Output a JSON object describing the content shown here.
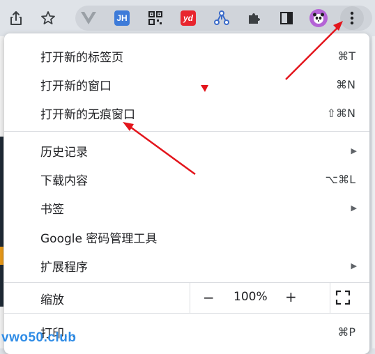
{
  "toolbar": {
    "icons": [
      "share-icon",
      "star-icon",
      "vue-devtools-icon",
      "jh-extension-icon",
      "qr-code-icon",
      "youdao-icon",
      "graph-extension-icon",
      "puzzle-extensions-icon",
      "side-panel-icon",
      "profile-avatar",
      "more-menu-icon"
    ],
    "jh_badge": "JH",
    "yd_badge": "yd"
  },
  "menu": {
    "new_tab": {
      "label": "打开新的标签页",
      "shortcut": "⌘T"
    },
    "new_window": {
      "label": "打开新的窗口",
      "shortcut": "⌘N"
    },
    "incognito": {
      "label": "打开新的无痕窗口",
      "shortcut": "⇧⌘N"
    },
    "history": {
      "label": "历史记录"
    },
    "downloads": {
      "label": "下载内容",
      "shortcut": "⌥⌘L"
    },
    "bookmarks": {
      "label": "书签"
    },
    "password_manager": {
      "label": "Google 密码管理工具"
    },
    "extensions": {
      "label": "扩展程序"
    },
    "zoom": {
      "label": "缩放",
      "minus": "−",
      "value": "100%",
      "plus": "+"
    },
    "print": {
      "label": "打印...",
      "shortcut": "⌘P"
    }
  },
  "watermark": "vwo50.club",
  "colors": {
    "annotation_arrow": "#e3151c",
    "watermark": "#2f8ce6",
    "avatar": "#b463d6",
    "youdao": "#e8252e",
    "jh": "#3d7bd9"
  }
}
